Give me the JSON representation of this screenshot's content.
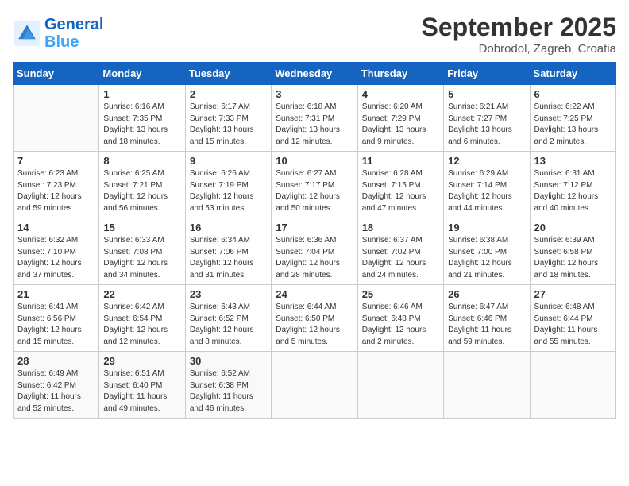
{
  "header": {
    "logo_line1": "General",
    "logo_line2": "Blue",
    "month": "September 2025",
    "location": "Dobrodol, Zagreb, Croatia"
  },
  "weekdays": [
    "Sunday",
    "Monday",
    "Tuesday",
    "Wednesday",
    "Thursday",
    "Friday",
    "Saturday"
  ],
  "weeks": [
    [
      {
        "day": null,
        "info": null
      },
      {
        "day": "1",
        "info": "Sunrise: 6:16 AM\nSunset: 7:35 PM\nDaylight: 13 hours\nand 18 minutes."
      },
      {
        "day": "2",
        "info": "Sunrise: 6:17 AM\nSunset: 7:33 PM\nDaylight: 13 hours\nand 15 minutes."
      },
      {
        "day": "3",
        "info": "Sunrise: 6:18 AM\nSunset: 7:31 PM\nDaylight: 13 hours\nand 12 minutes."
      },
      {
        "day": "4",
        "info": "Sunrise: 6:20 AM\nSunset: 7:29 PM\nDaylight: 13 hours\nand 9 minutes."
      },
      {
        "day": "5",
        "info": "Sunrise: 6:21 AM\nSunset: 7:27 PM\nDaylight: 13 hours\nand 6 minutes."
      },
      {
        "day": "6",
        "info": "Sunrise: 6:22 AM\nSunset: 7:25 PM\nDaylight: 13 hours\nand 2 minutes."
      }
    ],
    [
      {
        "day": "7",
        "info": "Sunrise: 6:23 AM\nSunset: 7:23 PM\nDaylight: 12 hours\nand 59 minutes."
      },
      {
        "day": "8",
        "info": "Sunrise: 6:25 AM\nSunset: 7:21 PM\nDaylight: 12 hours\nand 56 minutes."
      },
      {
        "day": "9",
        "info": "Sunrise: 6:26 AM\nSunset: 7:19 PM\nDaylight: 12 hours\nand 53 minutes."
      },
      {
        "day": "10",
        "info": "Sunrise: 6:27 AM\nSunset: 7:17 PM\nDaylight: 12 hours\nand 50 minutes."
      },
      {
        "day": "11",
        "info": "Sunrise: 6:28 AM\nSunset: 7:15 PM\nDaylight: 12 hours\nand 47 minutes."
      },
      {
        "day": "12",
        "info": "Sunrise: 6:29 AM\nSunset: 7:14 PM\nDaylight: 12 hours\nand 44 minutes."
      },
      {
        "day": "13",
        "info": "Sunrise: 6:31 AM\nSunset: 7:12 PM\nDaylight: 12 hours\nand 40 minutes."
      }
    ],
    [
      {
        "day": "14",
        "info": "Sunrise: 6:32 AM\nSunset: 7:10 PM\nDaylight: 12 hours\nand 37 minutes."
      },
      {
        "day": "15",
        "info": "Sunrise: 6:33 AM\nSunset: 7:08 PM\nDaylight: 12 hours\nand 34 minutes."
      },
      {
        "day": "16",
        "info": "Sunrise: 6:34 AM\nSunset: 7:06 PM\nDaylight: 12 hours\nand 31 minutes."
      },
      {
        "day": "17",
        "info": "Sunrise: 6:36 AM\nSunset: 7:04 PM\nDaylight: 12 hours\nand 28 minutes."
      },
      {
        "day": "18",
        "info": "Sunrise: 6:37 AM\nSunset: 7:02 PM\nDaylight: 12 hours\nand 24 minutes."
      },
      {
        "day": "19",
        "info": "Sunrise: 6:38 AM\nSunset: 7:00 PM\nDaylight: 12 hours\nand 21 minutes."
      },
      {
        "day": "20",
        "info": "Sunrise: 6:39 AM\nSunset: 6:58 PM\nDaylight: 12 hours\nand 18 minutes."
      }
    ],
    [
      {
        "day": "21",
        "info": "Sunrise: 6:41 AM\nSunset: 6:56 PM\nDaylight: 12 hours\nand 15 minutes."
      },
      {
        "day": "22",
        "info": "Sunrise: 6:42 AM\nSunset: 6:54 PM\nDaylight: 12 hours\nand 12 minutes."
      },
      {
        "day": "23",
        "info": "Sunrise: 6:43 AM\nSunset: 6:52 PM\nDaylight: 12 hours\nand 8 minutes."
      },
      {
        "day": "24",
        "info": "Sunrise: 6:44 AM\nSunset: 6:50 PM\nDaylight: 12 hours\nand 5 minutes."
      },
      {
        "day": "25",
        "info": "Sunrise: 6:46 AM\nSunset: 6:48 PM\nDaylight: 12 hours\nand 2 minutes."
      },
      {
        "day": "26",
        "info": "Sunrise: 6:47 AM\nSunset: 6:46 PM\nDaylight: 11 hours\nand 59 minutes."
      },
      {
        "day": "27",
        "info": "Sunrise: 6:48 AM\nSunset: 6:44 PM\nDaylight: 11 hours\nand 55 minutes."
      }
    ],
    [
      {
        "day": "28",
        "info": "Sunrise: 6:49 AM\nSunset: 6:42 PM\nDaylight: 11 hours\nand 52 minutes."
      },
      {
        "day": "29",
        "info": "Sunrise: 6:51 AM\nSunset: 6:40 PM\nDaylight: 11 hours\nand 49 minutes."
      },
      {
        "day": "30",
        "info": "Sunrise: 6:52 AM\nSunset: 6:38 PM\nDaylight: 11 hours\nand 46 minutes."
      },
      {
        "day": null,
        "info": null
      },
      {
        "day": null,
        "info": null
      },
      {
        "day": null,
        "info": null
      },
      {
        "day": null,
        "info": null
      }
    ]
  ]
}
